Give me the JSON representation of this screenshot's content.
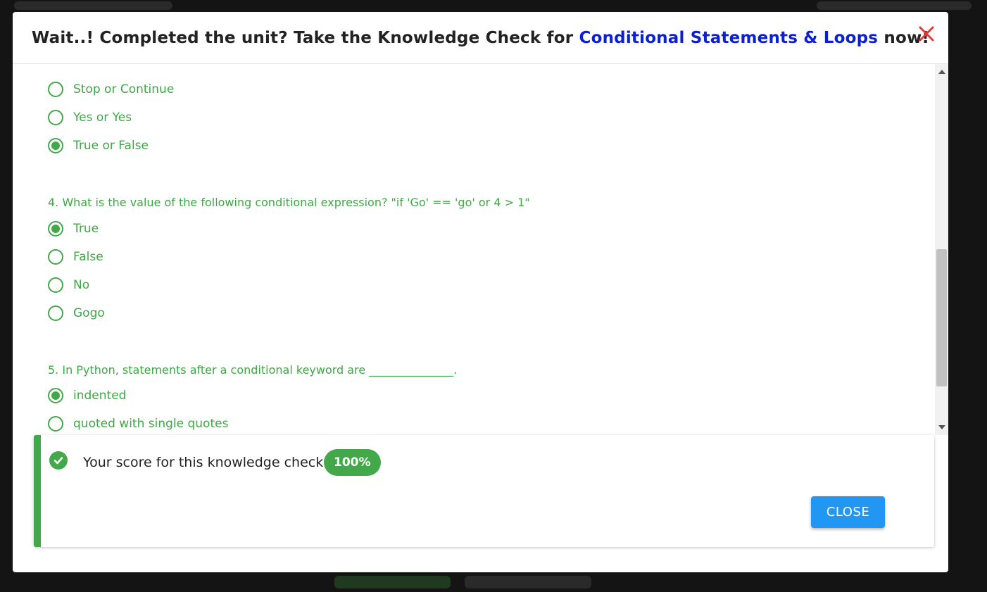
{
  "modal": {
    "title_prefix": "Wait..! Completed the unit? Take the Knowledge Check for ",
    "title_link": "Conditional Statements & Loops",
    "title_suffix": " now!",
    "close_icon": "close-x-icon",
    "colors": {
      "accent_green": "#43a84a",
      "link_blue": "#0b1fd6",
      "close_red": "#e53935",
      "button_blue": "#2196f3"
    }
  },
  "quiz": {
    "q3_options": [
      {
        "label": "Stop or Continue",
        "selected": false
      },
      {
        "label": "Yes or Yes",
        "selected": false
      },
      {
        "label": "True or False",
        "selected": true
      }
    ],
    "q4": {
      "text": "4. What is the value of the following conditional expression? \"if 'Go' == 'go' or 4 > 1\"",
      "options": [
        {
          "label": "True",
          "selected": true
        },
        {
          "label": "False",
          "selected": false
        },
        {
          "label": "No",
          "selected": false
        },
        {
          "label": "Gogo",
          "selected": false
        }
      ]
    },
    "q5": {
      "text": "5. In Python, statements after a conditional keyword are _______________.",
      "options": [
        {
          "label": "indented",
          "selected": true
        },
        {
          "label": "quoted with single quotes",
          "selected": false
        }
      ]
    }
  },
  "result": {
    "score_label": "Your score for this knowledge check:",
    "score_value": "100%",
    "close_button": "CLOSE"
  }
}
